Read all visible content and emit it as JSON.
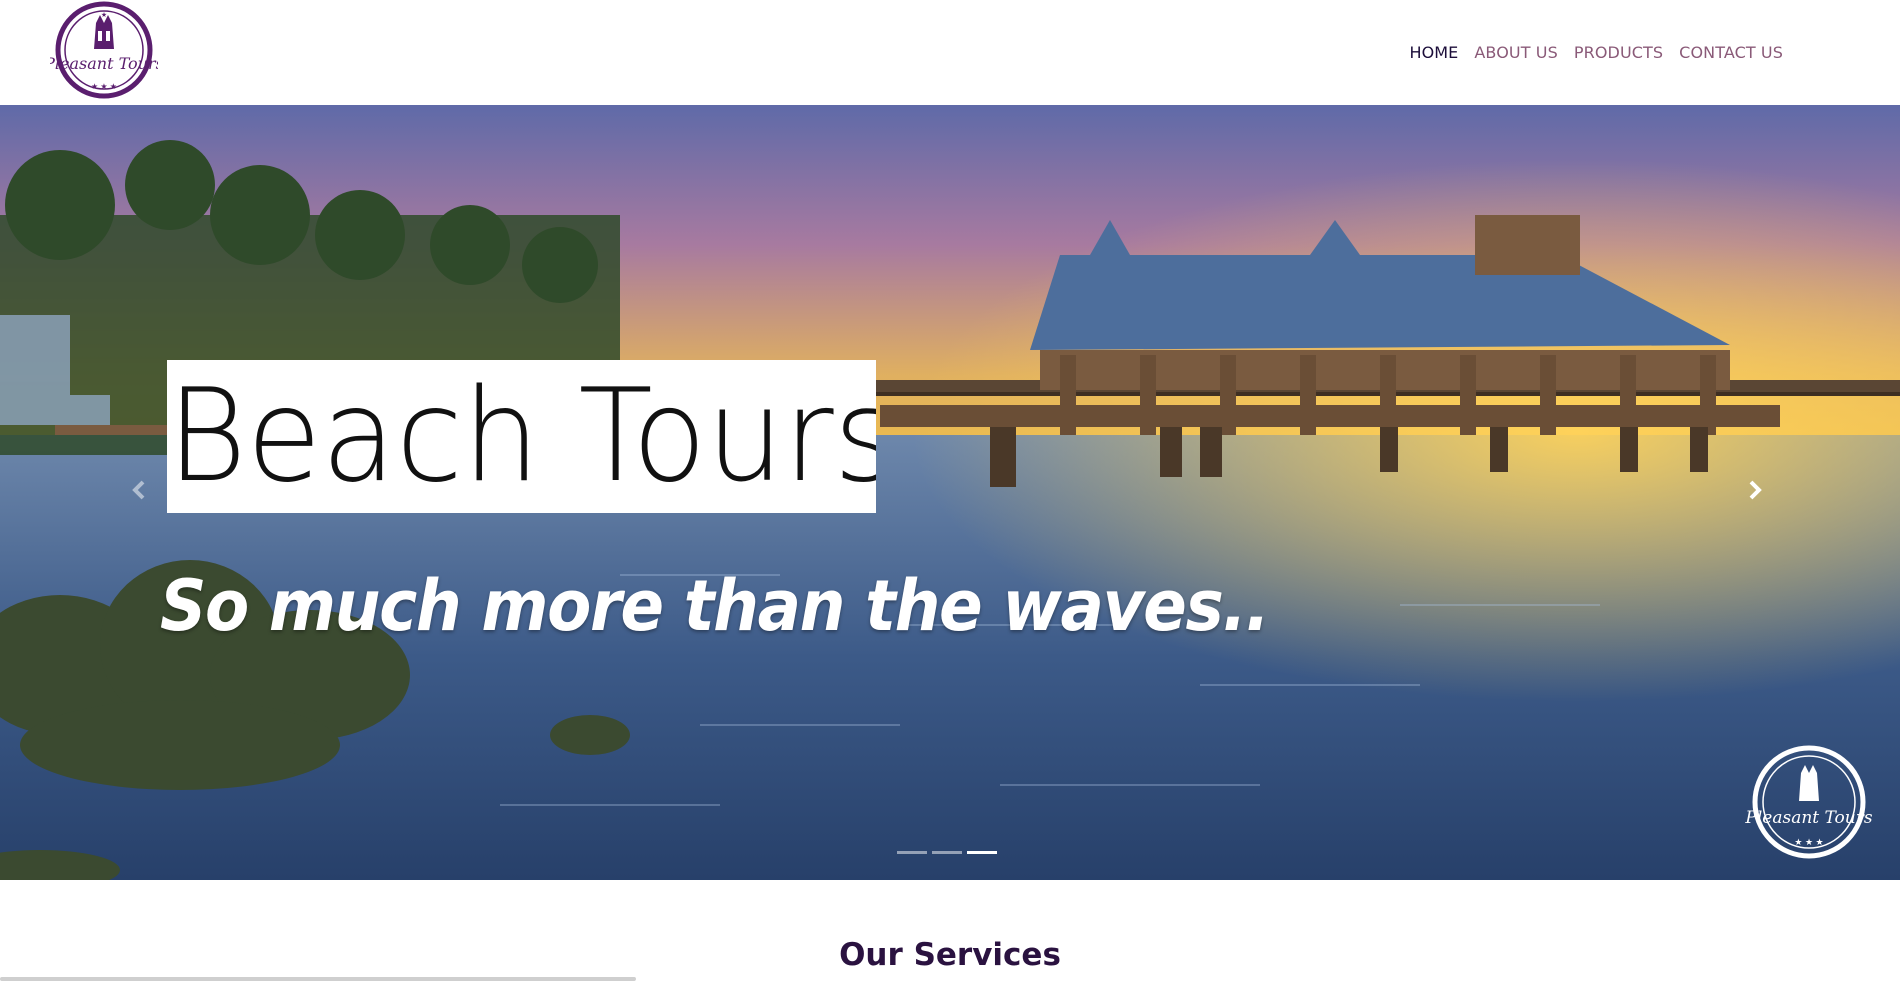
{
  "header": {
    "logo_text": "Pleasant Tours",
    "nav": [
      {
        "label": "HOME",
        "active": true
      },
      {
        "label": "ABOUT US",
        "active": false
      },
      {
        "label": "PRODUCTS",
        "active": false
      },
      {
        "label": "CONTACT US",
        "active": false
      }
    ]
  },
  "hero": {
    "title": "Beach Tours",
    "subtitle": "So much more than the waves..",
    "prev_icon": "chevron-left-icon",
    "next_icon": "chevron-right-icon",
    "slides_count": 3,
    "active_slide": 3,
    "watermark_text": "Pleasant Tours"
  },
  "services": {
    "title": "Our Services"
  },
  "colors": {
    "brand_purple": "#5a1e6e",
    "nav_inactive": "#8a5a78",
    "nav_active": "#1c0e3a"
  }
}
